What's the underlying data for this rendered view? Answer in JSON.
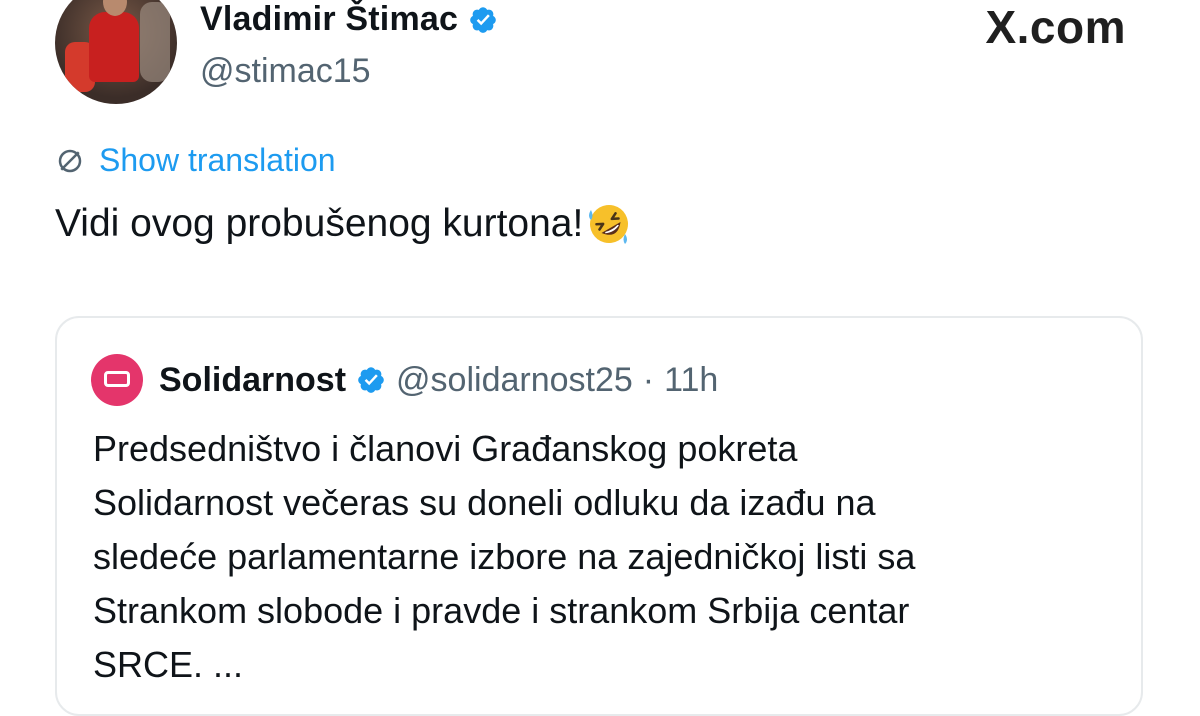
{
  "author": {
    "display_name": "Vladimir Štimac",
    "handle": "@stimac15",
    "verified": true
  },
  "brand_label": "X.com",
  "translate_label": "Show translation",
  "tweet": {
    "text": "Vidi ovog probušenog kurtona!",
    "emoji": "rolling-on-the-floor-laughing"
  },
  "quoted_tweet": {
    "display_name": "Solidarnost",
    "verified": true,
    "handle": "@solidarnost25",
    "separator": "·",
    "time": "11h",
    "lines": [
      "Predsedništvo i članovi Građanskog pokreta",
      "Solidarnost večeras su doneli odluku da izađu na",
      "sledeće parlamentarne izbore na zajedničkoj listi sa",
      "Strankom slobode i pravde i strankom Srbija centar",
      "SRCE. ..."
    ]
  },
  "colors": {
    "link_blue": "#1d9bf0",
    "secondary_text": "#536471",
    "primary_text": "#0f1419",
    "quote_avatar": "#e4356b"
  }
}
